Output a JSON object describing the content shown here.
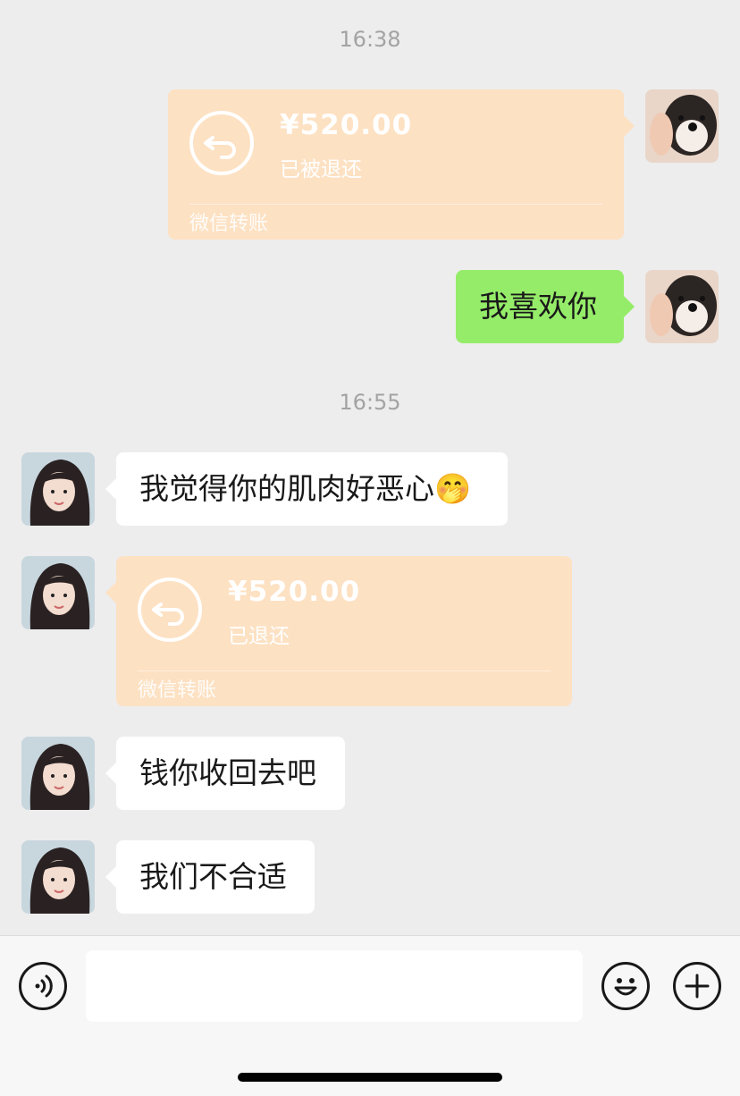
{
  "timestamps": [
    "16:38",
    "16:55"
  ],
  "messages": {
    "sent_transfer": {
      "amount": "¥520.00",
      "status": "已被退还",
      "footer": "微信转账",
      "icon": "return-arrow-icon"
    },
    "sent_text": "我喜欢你",
    "recv_text_1": "我觉得你的肌肉好恶心",
    "recv_text_1_emoji": "🤭",
    "recv_transfer": {
      "amount": "¥520.00",
      "status": "已退还",
      "footer": "微信转账",
      "icon": "return-arrow-icon"
    },
    "recv_text_2": "钱你收回去吧",
    "recv_text_3": "我们不合适"
  },
  "input_bar": {
    "voice_icon": "voice-icon",
    "emoji_icon": "smile-emoji-icon",
    "plus_icon": "plus-icon",
    "text_value": ""
  },
  "colors": {
    "background": "#ededed",
    "green_bubble": "#95ec69",
    "transfer_bubble": "#fde1c3",
    "white_bubble": "#ffffff"
  }
}
